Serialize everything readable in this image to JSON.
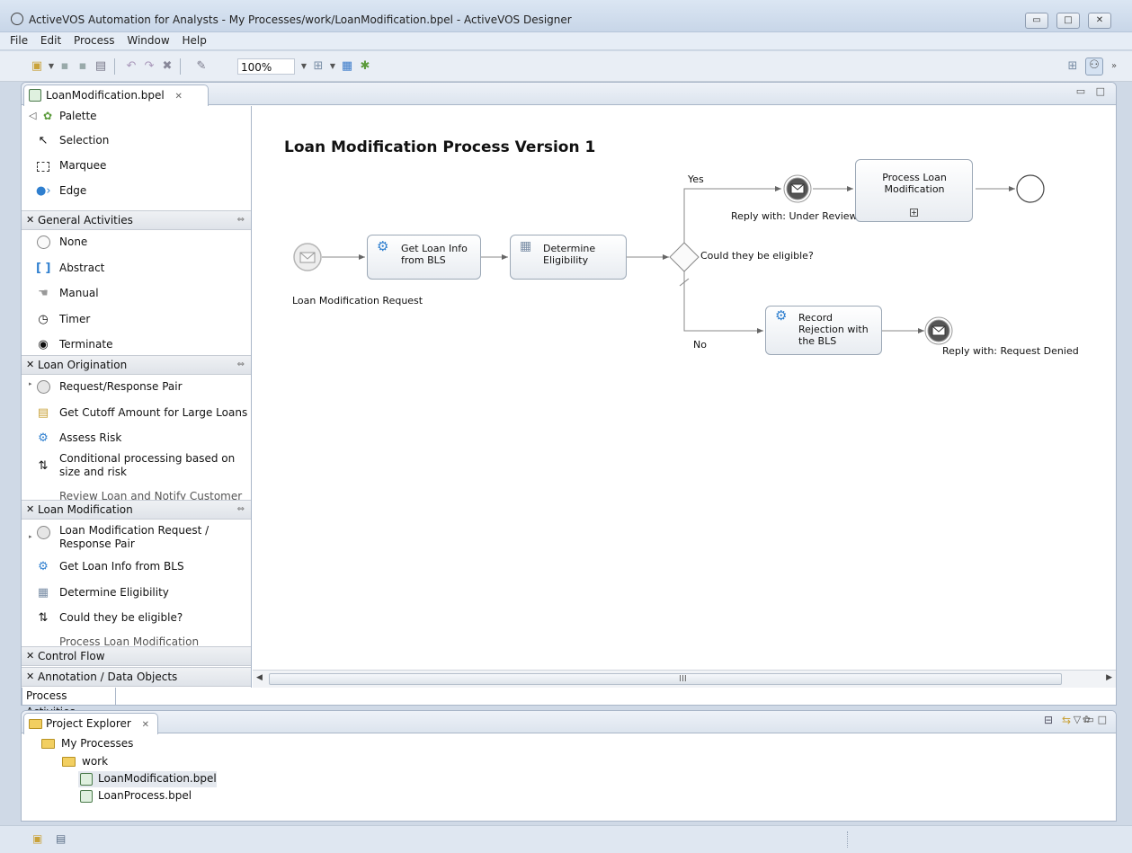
{
  "window": {
    "title": "ActiveVOS Automation for Analysts - My Processes/work/LoanModification.bpel - ActiveVOS Designer",
    "buttons": [
      "minimize",
      "maximize",
      "close"
    ]
  },
  "menu": [
    "File",
    "Edit",
    "Process",
    "Window",
    "Help"
  ],
  "toolbar": {
    "zoom": "100%"
  },
  "editor": {
    "tab_label": "LoanModification.bpel"
  },
  "palette": {
    "title": "Palette",
    "tools": [
      "Selection",
      "Marquee",
      "Edge"
    ],
    "drawers": [
      {
        "name": "General Activities",
        "items": [
          "None",
          "Abstract",
          "Manual",
          "Timer",
          "Terminate"
        ]
      },
      {
        "name": "Loan Origination",
        "items": [
          "Request/Response Pair",
          "Get Cutoff Amount for Large Loans",
          "Assess Risk",
          "Conditional processing based on size and risk",
          "Review Loan and Notify Customer"
        ]
      },
      {
        "name": "Loan Modification",
        "items": [
          "Loan Modification Request / Response Pair",
          "Get Loan Info from BLS",
          "Determine Eligibility",
          "Could they be eligible?",
          "Process Loan Modification"
        ]
      },
      {
        "name": "Control Flow",
        "items": []
      },
      {
        "name": "Annotation / Data Objects",
        "items": []
      }
    ],
    "bottom_tab": "Process Activities"
  },
  "diagram": {
    "title": "Loan Modification Process Version 1",
    "start_label": "Loan Modification Request",
    "task_get_loan_info": "Get Loan Info from BLS",
    "task_determine": "Determine Eligibility",
    "gateway_label": "Could they be eligible?",
    "branch_yes": "Yes",
    "branch_no": "No",
    "reply_review": "Reply with: Under Review",
    "task_process": "Process Loan Modification",
    "task_record": "Record Rejection with the BLS",
    "reply_denied": "Reply with: Request Denied"
  },
  "explorer": {
    "tab_label": "Project Explorer",
    "root": "My Processes",
    "folder": "work",
    "files": [
      "LoanModification.bpel",
      "LoanProcess.bpel"
    ]
  }
}
